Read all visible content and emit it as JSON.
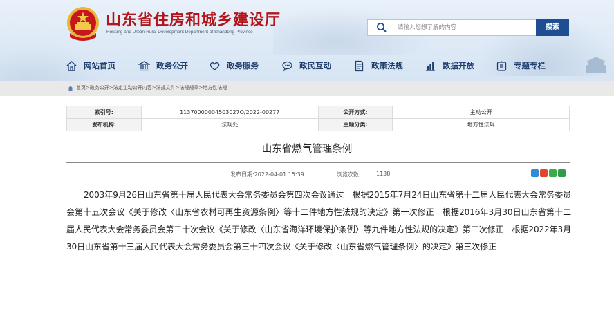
{
  "header": {
    "site_title": "山东省住房和城乡建设厅",
    "site_subtitle": "Housing and Urban-Rural Development Department of Shandong Province",
    "emblem_icon": "national-emblem-icon"
  },
  "search": {
    "placeholder": "请输入您想了解的内容",
    "value": "",
    "button_label": "搜索"
  },
  "nav": {
    "items": [
      {
        "label": "网站首页",
        "icon": "home-icon"
      },
      {
        "label": "政务公开",
        "icon": "government-building-icon"
      },
      {
        "label": "政务服务",
        "icon": "heart-hands-icon"
      },
      {
        "label": "政民互动",
        "icon": "chat-icon"
      },
      {
        "label": "政策法规",
        "icon": "document-icon"
      },
      {
        "label": "数据开放",
        "icon": "bar-chart-icon"
      },
      {
        "label": "专题专栏",
        "icon": "folder-icon"
      }
    ]
  },
  "breadcrumb": {
    "text": "首页>政务公开>法定主动公开内容>法规文件>法规规章>地方性法规"
  },
  "meta": {
    "index_label": "索引号:",
    "index_value": "11370000004503027O/2022-00277",
    "disclosure_label": "公开方式:",
    "disclosure_value": "主动公开",
    "issuer_label": "发布机构:",
    "issuer_value": "法规处",
    "category_label": "主题分类:",
    "category_value": "地方性法规"
  },
  "article": {
    "title": "山东省燃气管理条例",
    "publish_date": "发布日期:2022-04-01 15:39",
    "views_label": "浏览次数:",
    "views_value": "1138",
    "body": "2003年9月26日山东省第十届人民代表大会常务委员会第四次会议通过　根据2015年7月24日山东省第十二届人民代表大会常务委员会第十五次会议《关于修改〈山东省农村可再生资源条例〉等十二件地方性法规的决定》第一次修正　根据2016年3月30日山东省第十二届人民代表大会常务委员会第二十次会议《关于修改〈山东省海洋环境保护条例〉等九件地方性法规的决定》第二次修正　根据2022年3月30日山东省第十三届人民代表大会常务委员会第三十四次会议《关于修改〈山东省燃气管理条例〉的决定》第三次修正"
  },
  "share": {
    "icons": [
      "share-qzone-icon",
      "share-weibo-icon",
      "share-wechat-icon",
      "share-douban-icon"
    ],
    "colors": [
      "#2f8dd8",
      "#e0462c",
      "#3dab49",
      "#2f9d47"
    ]
  },
  "colors": {
    "brand_red": "#b3151b",
    "nav_blue": "#1f3f6e",
    "search_button": "#1d4e91"
  }
}
